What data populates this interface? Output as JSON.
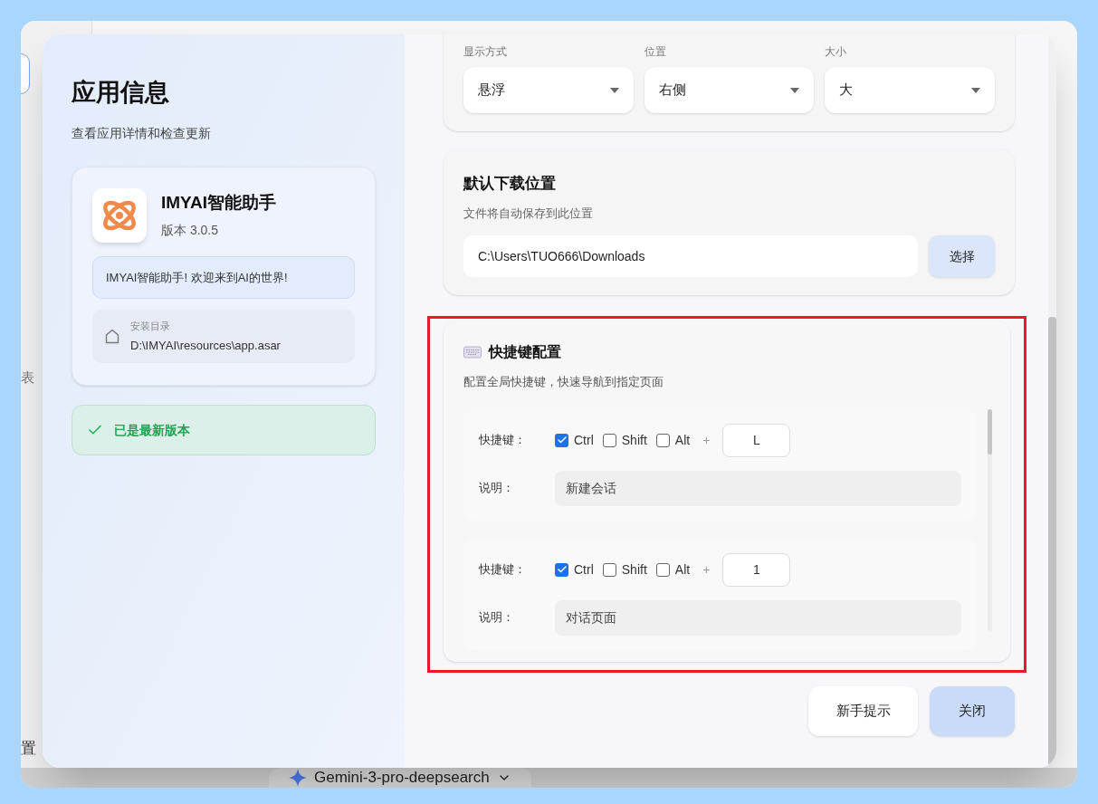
{
  "background_app": {
    "sidebar_texts": [
      "表",
      "置"
    ],
    "model_selector": "Gemini-3-pro-deepsearch"
  },
  "info_panel": {
    "title": "应用信息",
    "subtitle": "查看应用详情和检查更新",
    "app_name": "IMYAI智能助手",
    "version": "版本 3.0.5",
    "welcome": "IMYAI智能助手! 欢迎来到AI的世界!",
    "install_dir_label": "安装目录",
    "install_dir": "D:\\IMYAI\\resources\\app.asar",
    "update_status": "已是最新版本"
  },
  "display_settings": {
    "selects": [
      {
        "label": "显示方式",
        "value": "悬浮"
      },
      {
        "label": "位置",
        "value": "右侧"
      },
      {
        "label": "大小",
        "value": "大"
      }
    ]
  },
  "download": {
    "title": "默认下载位置",
    "subtitle": "文件将自动保存到此位置",
    "path": "C:\\Users\\TUO666\\Downloads",
    "button": "选择"
  },
  "shortcuts": {
    "title": "快捷键配置",
    "subtitle": "配置全局快捷键，快速导航到指定页面",
    "highlighted": true,
    "items": [
      {
        "key_label": "快捷键：",
        "modifiers": [
          {
            "label": "Ctrl",
            "checked": true
          },
          {
            "label": "Shift",
            "checked": false
          },
          {
            "label": "Alt",
            "checked": false
          }
        ],
        "plus": "+",
        "key": "L",
        "desc_label": "说明：",
        "description": "新建会话"
      },
      {
        "key_label": "快捷键：",
        "modifiers": [
          {
            "label": "Ctrl",
            "checked": true
          },
          {
            "label": "Shift",
            "checked": false
          },
          {
            "label": "Alt",
            "checked": false
          }
        ],
        "plus": "+",
        "key": "1",
        "desc_label": "说明：",
        "description": "对话页面"
      }
    ]
  },
  "buttons": [
    {
      "label": "新手提示",
      "primary": false
    },
    {
      "label": "关闭",
      "primary": true
    }
  ]
}
